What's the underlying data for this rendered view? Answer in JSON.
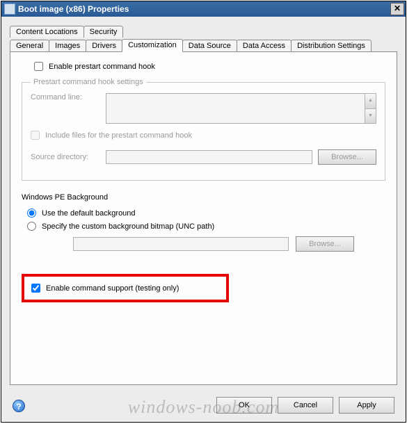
{
  "window": {
    "title": "Boot image (x86) Properties"
  },
  "tabs": {
    "row1": [
      "Content Locations",
      "Security"
    ],
    "row2": [
      "General",
      "Images",
      "Drivers",
      "Customization",
      "Data Source",
      "Data Access",
      "Distribution Settings"
    ],
    "active": "Customization"
  },
  "prestart": {
    "enable_label": "Enable prestart command hook",
    "enable_checked": false,
    "fieldset_legend": "Prestart command hook settings",
    "command_line_label": "Command line:",
    "command_line_value": "",
    "include_files_label": "Include files for the prestart command hook",
    "include_files_checked": false,
    "source_dir_label": "Source directory:",
    "source_dir_value": "",
    "browse_label": "Browse..."
  },
  "pe_background": {
    "title": "Windows PE Background",
    "opt_default_label": "Use the default background",
    "opt_custom_label": "Specify the custom background bitmap (UNC path)",
    "selected": "default",
    "path_value": "",
    "browse_label": "Browse..."
  },
  "cmd_support": {
    "label": "Enable command support (testing only)",
    "checked": true
  },
  "buttons": {
    "ok": "OK",
    "cancel": "Cancel",
    "apply": "Apply"
  },
  "watermark": "windows-noob.com"
}
